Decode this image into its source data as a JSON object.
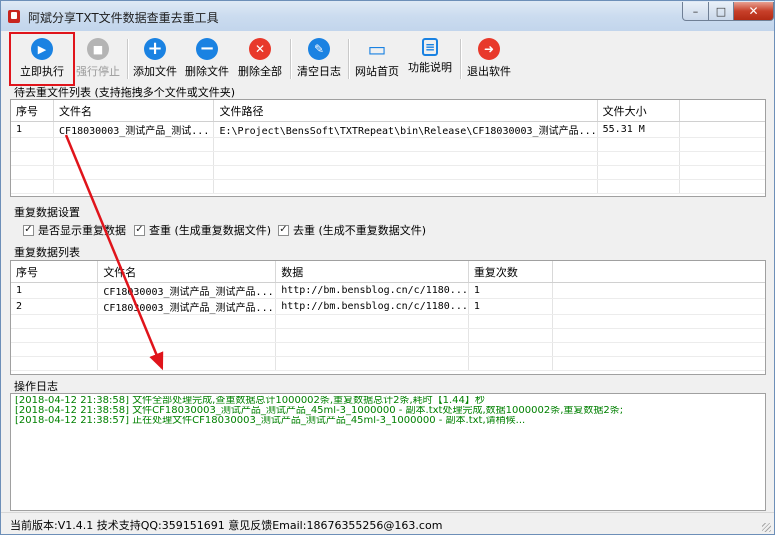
{
  "window": {
    "title": "阿斌分享TXT文件数据查重去重工具",
    "minimize_label": "–",
    "maximize_label": "□",
    "close_label": "✕"
  },
  "toolbar": {
    "buttons": [
      {
        "label": "立即执行",
        "icon": "play-icon",
        "color": "#1a82e2",
        "glyph": "▶",
        "enabled": true
      },
      {
        "label": "强行停止",
        "icon": "stop-icon",
        "color": "#b4b4b4",
        "glyph": "■",
        "enabled": false
      },
      {
        "label": "添加文件",
        "icon": "plus-icon",
        "color": "#1a82e2",
        "glyph": "+",
        "enabled": true
      },
      {
        "label": "删除文件",
        "icon": "minus-icon",
        "color": "#1a82e2",
        "glyph": "−",
        "enabled": true
      },
      {
        "label": "删除全部",
        "icon": "close-icon",
        "color": "#e8392b",
        "glyph": "✕",
        "enabled": true
      },
      {
        "label": "清空日志",
        "icon": "broom-icon",
        "color": "#1a82e2",
        "glyph": "✎",
        "enabled": true
      },
      {
        "label": "网站首页",
        "icon": "monitor-icon",
        "color": "#1a82e2",
        "glyph": "▭",
        "enabled": true
      },
      {
        "label": "功能说明",
        "icon": "document-icon",
        "color": "#1a82e2",
        "glyph": "≡",
        "enabled": true
      },
      {
        "label": "退出软件",
        "icon": "exit-icon",
        "color": "#e8392b",
        "glyph": "➜",
        "enabled": true
      }
    ]
  },
  "file_section": {
    "label": "待去重文件列表 (支持拖拽多个文件或文件夹)",
    "columns": [
      "序号",
      "文件名",
      "文件路径",
      "文件大小"
    ],
    "rows": [
      [
        "1",
        "CF18030003_测试产品_测试...",
        "E:\\Project\\BensSoft\\TXTRepeat\\bin\\Release\\CF18030003_测试产品...",
        "55.31 M"
      ]
    ]
  },
  "settings": {
    "label": "重复数据设置",
    "options": [
      {
        "label": "是否显示重复数据",
        "checked": true
      },
      {
        "label": "查重 (生成重复数据文件)",
        "checked": true
      },
      {
        "label": "去重 (生成不重复数据文件)",
        "checked": true
      }
    ]
  },
  "dup_section": {
    "label": "重复数据列表",
    "columns": [
      "序号",
      "文件名",
      "数据",
      "重复次数"
    ],
    "rows": [
      [
        "1",
        "CF18030003_测试产品_测试产品...",
        "http://bm.bensblog.cn/c/1180...",
        "1"
      ],
      [
        "2",
        "CF18030003_测试产品_测试产品...",
        "http://bm.bensblog.cn/c/1180...",
        "1"
      ]
    ]
  },
  "log_section": {
    "label": "操作日志",
    "lines": [
      "[2018-04-12 21:38:58] 文件全部处理完成,查重数据总计1000002条,重复数据总计2条,耗时【1.44】秒",
      "[2018-04-12 21:38:58] 文件CF18030003_测试产品_测试产品_45ml-3_1000000 - 副本.txt处理完成,数据1000002条,重复数据2条;",
      "[2018-04-12 21:38:57] 正在处理文件CF18030003_测试产品_测试产品_45ml-3_1000000 - 副本.txt,请稍候..."
    ]
  },
  "status": {
    "text": "当前版本:V1.4.1  技术支持QQ:359151691  意见反馈Email:18676355256@163.com"
  },
  "colors": {
    "annotation_red": "#e0141b",
    "log_green": "#008000"
  }
}
